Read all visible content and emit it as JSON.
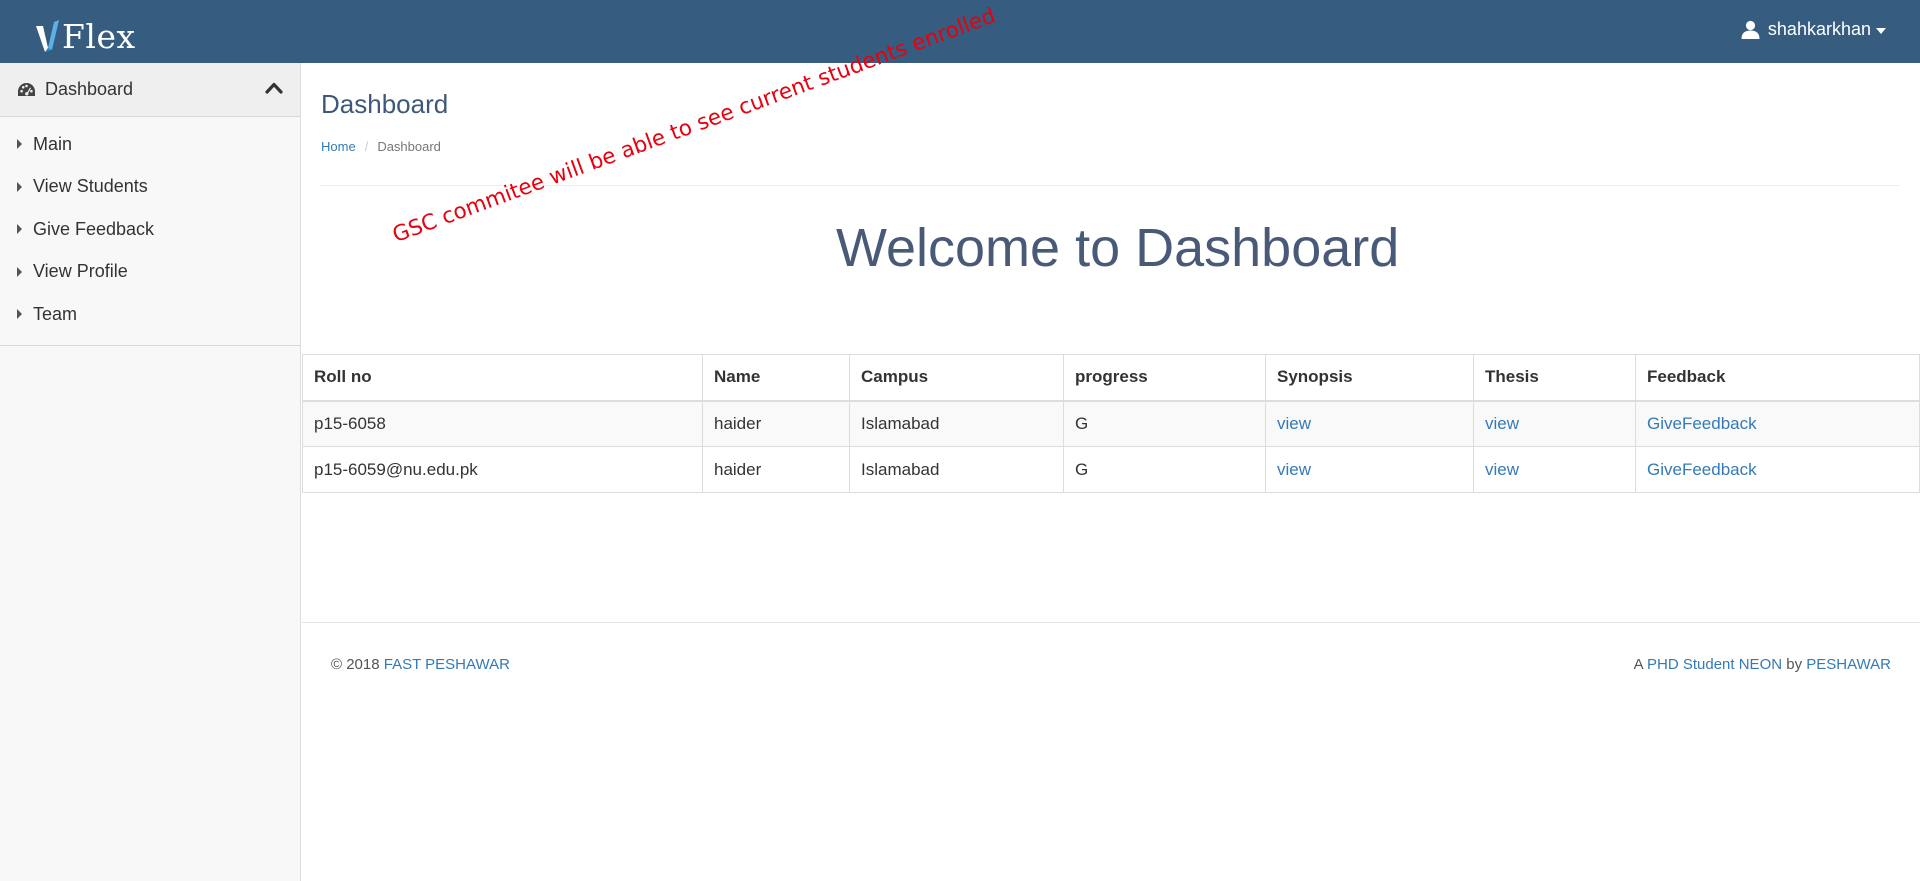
{
  "header": {
    "logo_text": "Flex",
    "username": "shahkarkhan",
    "icons": {
      "user": "user-icon",
      "caret": "caret-down-icon"
    },
    "background": "#365c7f"
  },
  "sidebar": {
    "section_label": "Dashboard",
    "section_icon": "dashboard-gauge-icon",
    "toggle_icon": "chevron-up-icon",
    "items": [
      {
        "label": "Main"
      },
      {
        "label": "View Students"
      },
      {
        "label": "Give Feedback"
      },
      {
        "label": "View Profile"
      },
      {
        "label": "Team"
      }
    ]
  },
  "main": {
    "page_title": "Dashboard",
    "breadcrumb": {
      "home": "Home",
      "current": "Dashboard"
    },
    "annotation": "GSC commitee will be able to see current students enrolled",
    "annotation_color": "#e8000f",
    "welcome": "Welcome to Dashboard"
  },
  "table": {
    "headers": [
      "Roll no",
      "Name",
      "Campus",
      "progress",
      "Synopsis",
      "Thesis",
      "Feedback"
    ],
    "rows": [
      {
        "roll_no": "p15-6058",
        "name": "haider",
        "campus": "Islamabad",
        "progress": "G",
        "synopsis": "view",
        "thesis": "view",
        "feedback": "GiveFeedback"
      },
      {
        "roll_no": "p15-6059@nu.edu.pk",
        "name": "haider",
        "campus": "Islamabad",
        "progress": "G",
        "synopsis": "view",
        "thesis": "view",
        "feedback": "GiveFeedback"
      }
    ]
  },
  "footer": {
    "copyright": "© 2018",
    "left_link": "FAST PESHAWAR",
    "right_prefix": "A",
    "right_link1": "PHD Student NEON",
    "right_mid": "by",
    "right_link2": "PESHAWAR"
  },
  "colors": {
    "link": "#337ab7",
    "heading": "#3e5977",
    "welcome": "#485a78"
  }
}
